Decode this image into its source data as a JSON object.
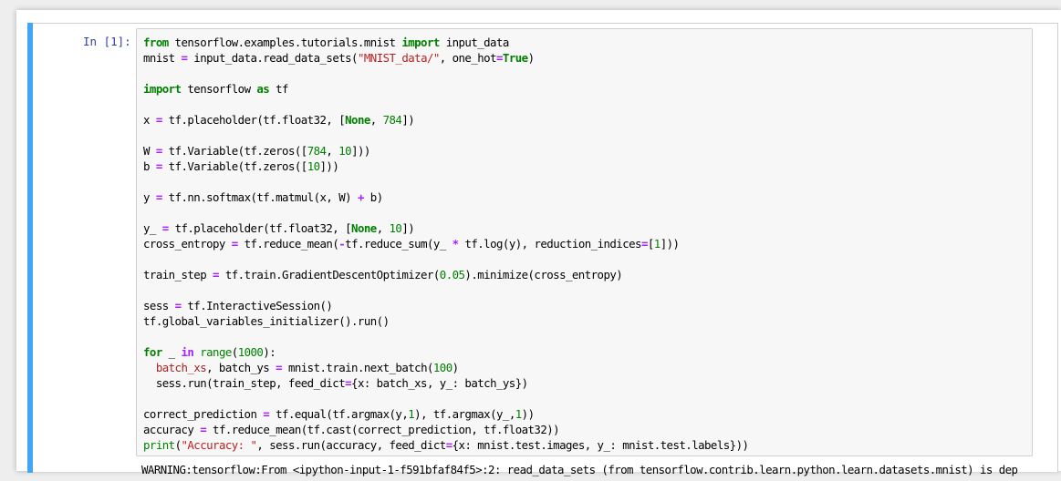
{
  "cell": {
    "prompt": "In [1]:",
    "code_lines": [
      [
        [
          "kw",
          "from"
        ],
        [
          "t",
          " tensorflow.examples.tutorials.mnist "
        ],
        [
          "kw",
          "import"
        ],
        [
          "t",
          " input_data"
        ]
      ],
      [
        [
          "t",
          "mnist "
        ],
        [
          "op",
          "="
        ],
        [
          "t",
          " input_data.read_data_sets("
        ],
        [
          "str",
          "\"MNIST_data/\""
        ],
        [
          "t",
          ", one_hot"
        ],
        [
          "op",
          "="
        ],
        [
          "kw",
          "True"
        ],
        [
          "t",
          ")"
        ]
      ],
      [],
      [
        [
          "kw",
          "import"
        ],
        [
          "t",
          " tensorflow "
        ],
        [
          "kw",
          "as"
        ],
        [
          "t",
          " tf"
        ]
      ],
      [],
      [
        [
          "t",
          "x "
        ],
        [
          "op",
          "="
        ],
        [
          "t",
          " tf.placeholder(tf.float32, ["
        ],
        [
          "kw",
          "None"
        ],
        [
          "t",
          ", "
        ],
        [
          "num",
          "784"
        ],
        [
          "t",
          "])"
        ]
      ],
      [],
      [
        [
          "t",
          "W "
        ],
        [
          "op",
          "="
        ],
        [
          "t",
          " tf.Variable(tf.zeros(["
        ],
        [
          "num",
          "784"
        ],
        [
          "t",
          ", "
        ],
        [
          "num",
          "10"
        ],
        [
          "t",
          "]))"
        ]
      ],
      [
        [
          "t",
          "b "
        ],
        [
          "op",
          "="
        ],
        [
          "t",
          " tf.Variable(tf.zeros(["
        ],
        [
          "num",
          "10"
        ],
        [
          "t",
          "]))"
        ]
      ],
      [],
      [
        [
          "t",
          "y "
        ],
        [
          "op",
          "="
        ],
        [
          "t",
          " tf.nn.softmax(tf.matmul(x, W) "
        ],
        [
          "op",
          "+"
        ],
        [
          "t",
          " b)"
        ]
      ],
      [],
      [
        [
          "t",
          "y_ "
        ],
        [
          "op",
          "="
        ],
        [
          "t",
          " tf.placeholder(tf.float32, ["
        ],
        [
          "kw",
          "None"
        ],
        [
          "t",
          ", "
        ],
        [
          "num",
          "10"
        ],
        [
          "t",
          "])"
        ]
      ],
      [
        [
          "t",
          "cross_entropy "
        ],
        [
          "op",
          "="
        ],
        [
          "t",
          " tf.reduce_mean("
        ],
        [
          "op",
          "-"
        ],
        [
          "t",
          "tf.reduce_sum(y_ "
        ],
        [
          "op",
          "*"
        ],
        [
          "t",
          " tf.log(y), reduction_indices"
        ],
        [
          "op",
          "="
        ],
        [
          "t",
          "["
        ],
        [
          "num",
          "1"
        ],
        [
          "t",
          "]))"
        ]
      ],
      [],
      [
        [
          "t",
          "train_step "
        ],
        [
          "op",
          "="
        ],
        [
          "t",
          " tf.train.GradientDescentOptimizer("
        ],
        [
          "num",
          "0.05"
        ],
        [
          "t",
          ").minimize(cross_entropy)"
        ]
      ],
      [],
      [
        [
          "t",
          "sess "
        ],
        [
          "op",
          "="
        ],
        [
          "t",
          " tf.InteractiveSession()"
        ]
      ],
      [
        [
          "t",
          "tf.global_variables_initializer().run()"
        ]
      ],
      [],
      [
        [
          "kw",
          "for"
        ],
        [
          "t",
          " _ "
        ],
        [
          "op",
          "in"
        ],
        [
          "t",
          " "
        ],
        [
          "bi",
          "range"
        ],
        [
          "t",
          "("
        ],
        [
          "num",
          "1000"
        ],
        [
          "t",
          "):"
        ]
      ],
      [
        [
          "t",
          "  "
        ],
        [
          "var",
          "batch_xs"
        ],
        [
          "t",
          ", batch_ys "
        ],
        [
          "op",
          "="
        ],
        [
          "t",
          " mnist.train.next_batch("
        ],
        [
          "num",
          "100"
        ],
        [
          "t",
          ")"
        ]
      ],
      [
        [
          "t",
          "  sess.run(train_step, feed_dict"
        ],
        [
          "op",
          "="
        ],
        [
          "t",
          "{x: batch_xs, y_: batch_ys})"
        ]
      ],
      [],
      [
        [
          "t",
          "correct_prediction "
        ],
        [
          "op",
          "="
        ],
        [
          "t",
          " tf.equal(tf.argmax(y,"
        ],
        [
          "num",
          "1"
        ],
        [
          "t",
          "), tf.argmax(y_,"
        ],
        [
          "num",
          "1"
        ],
        [
          "t",
          "))"
        ]
      ],
      [
        [
          "t",
          "accuracy "
        ],
        [
          "op",
          "="
        ],
        [
          "t",
          " tf.reduce_mean(tf.cast(correct_prediction, tf.float32))"
        ]
      ],
      [
        [
          "bi",
          "print"
        ],
        [
          "t",
          "("
        ],
        [
          "str",
          "\"Accuracy: \""
        ],
        [
          "t",
          ", sess.run(accuracy, feed_dict"
        ],
        [
          "op",
          "="
        ],
        [
          "t",
          "{x: mnist.test.images, y_: mnist.test.labels}))"
        ]
      ]
    ],
    "output": "WARNING:tensorflow:From <ipython-input-1-f591bfaf84f5>:2: read_data_sets (from tensorflow.contrib.learn.python.learn.datasets.mnist) is dep"
  },
  "colors": {
    "selected_bar": "#42a5f5",
    "prompt": "#303f9f",
    "keyword": "#008000",
    "operator": "#aa22ff",
    "string": "#ba2121"
  }
}
